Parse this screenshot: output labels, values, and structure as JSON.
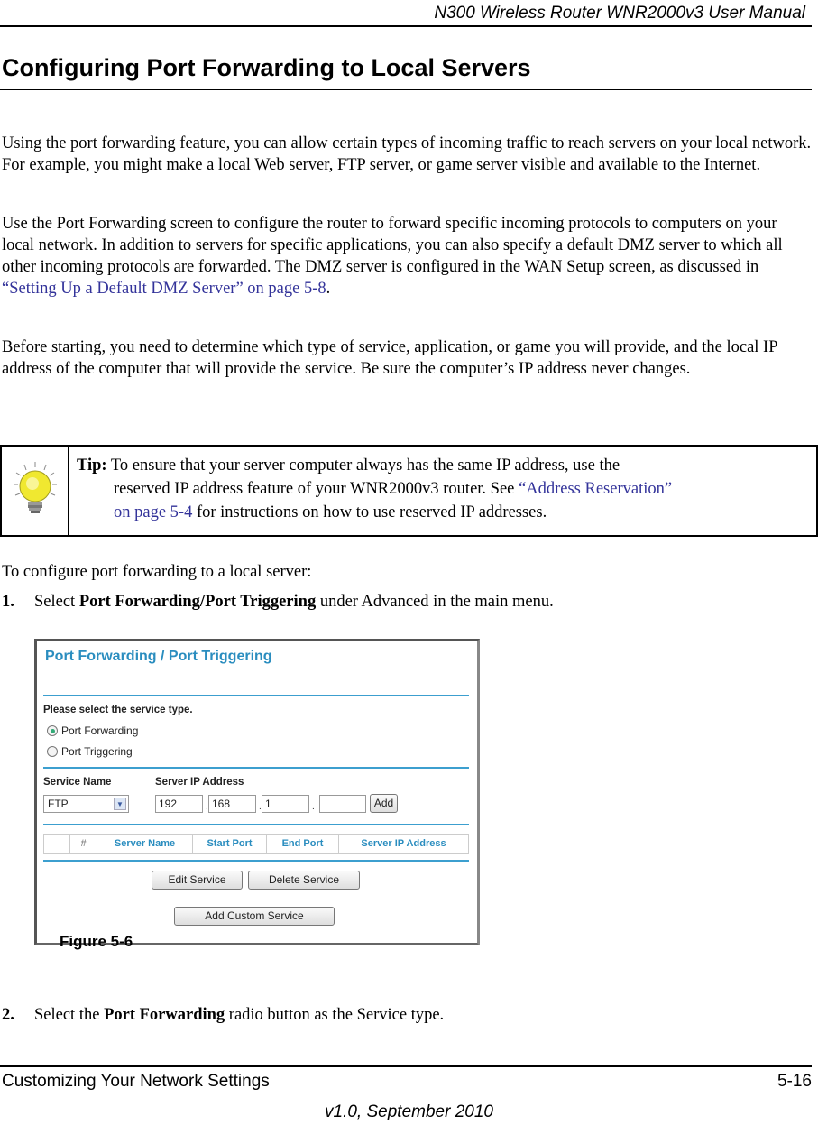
{
  "header": {
    "manual_title": "N300 Wireless Router WNR2000v3 User Manual"
  },
  "section_title": "Configuring Port Forwarding to Local Servers",
  "paragraphs": {
    "p1": "Using the port forwarding feature, you can allow certain types of incoming traffic to reach servers on your local network. For example, you might make a local Web server, FTP server, or game server visible and available to the Internet.",
    "p2_before_link": "Use the Port Forwarding screen to configure the router to forward specific incoming protocols to computers on your local network. In addition to servers for specific applications, you can also specify a default DMZ server to which all other incoming protocols are forwarded. The DMZ server is configured in the WAN Setup screen, as discussed in ",
    "p2_link": "“Setting Up a Default DMZ Server” on page 5-8",
    "p2_after_link": ".",
    "p3": "Before starting, you need to determine which type of service, application, or game you will provide, and the local IP address of the computer that will provide the service. Be sure the computer’s IP address never changes."
  },
  "tip": {
    "icon": "lightbulb-icon",
    "label": "Tip:",
    "text_before": " To ensure that your server computer always has the same IP address, use the",
    "text_line2_before": "reserved IP address feature of your WNR2000v3 router. See ",
    "link_part1": "“Address Reservation”",
    "link_part2": "on page 5-4",
    "text_after": " for instructions on how to use reserved IP addresses."
  },
  "intro": "To configure port forwarding to a local server:",
  "steps": [
    {
      "num": "1.",
      "before": "Select ",
      "bold": "Port Forwarding/Port Triggering",
      "after": " under Advanced in the main menu."
    },
    {
      "num": "2.",
      "before": "Select the ",
      "bold": "Port Forwarding",
      "after": " radio button as the Service type."
    }
  ],
  "screenshot": {
    "title": "Port Forwarding / Port Triggering",
    "service_type_label": "Please select the service type.",
    "radios": [
      {
        "label": "Port Forwarding",
        "selected": true
      },
      {
        "label": "Port Triggering",
        "selected": false
      }
    ],
    "service_name_label": "Service Name",
    "server_ip_label": "Server IP Address",
    "service_name_value": "FTP",
    "ip_octets": [
      "192",
      "168",
      "1",
      ""
    ],
    "add_button": "Add",
    "table_headers": [
      "",
      "#",
      "Server Name",
      "Start Port",
      "End Port",
      "Server IP Address"
    ],
    "edit_button": "Edit Service",
    "delete_button": "Delete Service",
    "add_custom_button": "Add Custom Service"
  },
  "figure_caption": "Figure 5-6",
  "footer": {
    "chapter": "Customizing Your Network Settings",
    "page": "5-16",
    "version": "v1.0, September 2010"
  }
}
